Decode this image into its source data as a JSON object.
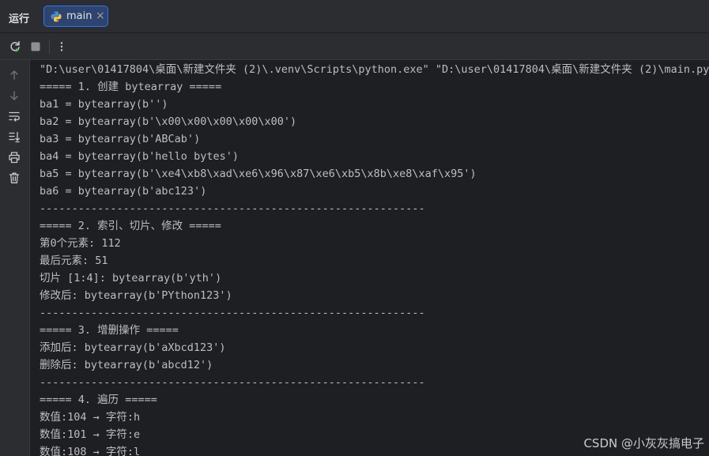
{
  "header": {
    "run_label": "运行",
    "tab": {
      "label": "main",
      "close": "×"
    }
  },
  "console": {
    "lines": [
      "\"D:\\user\\01417804\\桌面\\新建文件夹 (2)\\.venv\\Scripts\\python.exe\" \"D:\\user\\01417804\\桌面\\新建文件夹 (2)\\main.py\"",
      "===== 1. 创建 bytearray =====",
      "ba1 = bytearray(b'')",
      "ba2 = bytearray(b'\\x00\\x00\\x00\\x00\\x00')",
      "ba3 = bytearray(b'ABCab')",
      "ba4 = bytearray(b'hello bytes')",
      "ba5 = bytearray(b'\\xe4\\xb8\\xad\\xe6\\x96\\x87\\xe6\\xb5\\x8b\\xe8\\xaf\\x95')",
      "ba6 = bytearray(b'abc123')",
      "------------------------------------------------------------",
      "===== 2. 索引、切片、修改 =====",
      "第0个元素: 112",
      "最后元素: 51",
      "切片 [1:4]: bytearray(b'yth')",
      "修改后: bytearray(b'PYthon123')",
      "------------------------------------------------------------",
      "===== 3. 增删操作 =====",
      "添加后: bytearray(b'aXbcd123')",
      "删除后: bytearray(b'abcd12')",
      "------------------------------------------------------------",
      "===== 4. 遍历 =====",
      "数值:104 → 字符:h",
      "数值:101 → 字符:e",
      "数值:108 → 字符:l"
    ]
  },
  "watermark": "CSDN @小灰灰搞电子",
  "colors": {
    "accent": "#3574f0",
    "rerun_green": "#5fb865",
    "text": "#bcbec4"
  }
}
